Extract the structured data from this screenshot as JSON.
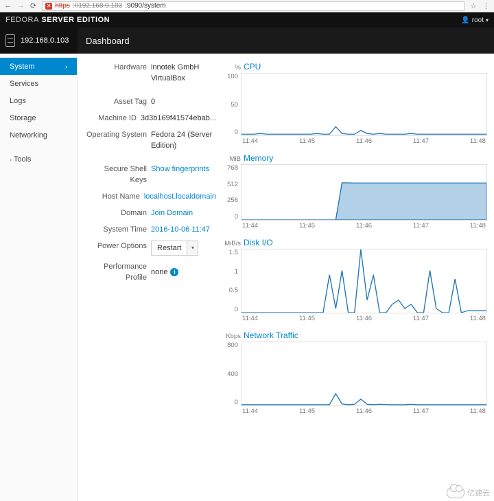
{
  "browser": {
    "url_scheme": "https",
    "url_host": "://192.168.0.103",
    "url_path": ":9090/system"
  },
  "brand": {
    "fedora": "FEDORA",
    "server": "SERVER EDITION"
  },
  "user": {
    "name": "root"
  },
  "host_tab": "192.168.0.103",
  "crumb": "Dashboard",
  "sidebar": {
    "items": [
      {
        "label": "System"
      },
      {
        "label": "Services"
      },
      {
        "label": "Logs"
      },
      {
        "label": "Storage"
      },
      {
        "label": "Networking"
      }
    ],
    "tools": "Tools"
  },
  "info": {
    "hardware_label": "Hardware",
    "hardware_value": "innotek GmbH\nVirtualBox",
    "asset_tag_label": "Asset Tag",
    "asset_tag_value": "0",
    "machine_id_label": "Machine ID",
    "machine_id_value": "3d3b169f41574ebab...",
    "os_label": "Operating System",
    "os_value": "Fedora 24 (Server\nEdition)",
    "ssh_label": "Secure Shell Keys",
    "ssh_value": "Show fingerprints",
    "host_label": "Host Name",
    "host_value": "localhost.localdomain",
    "domain_label": "Domain",
    "domain_value": "Join Domain",
    "time_label": "System Time",
    "time_value": "2016-10-06 11:47",
    "power_label": "Power Options",
    "power_value": "Restart",
    "perf_label": "Performance Profile",
    "perf_value": "none"
  },
  "x_ticks": [
    "11:44",
    "11:45",
    "11:46",
    "11:47",
    "11:48"
  ],
  "chart_data": [
    {
      "type": "line",
      "title": "CPU",
      "unit": "%",
      "ylim": [
        0,
        100
      ],
      "y_ticks": [
        100,
        50,
        0
      ],
      "x": [
        "11:44",
        "11:45",
        "11:46",
        "11:47",
        "11:48"
      ],
      "values": [
        2,
        2,
        2,
        3,
        2,
        2,
        2,
        2,
        2,
        2,
        2,
        2,
        3,
        2,
        2,
        14,
        3,
        2,
        2,
        8,
        3,
        2,
        3,
        2,
        2,
        2,
        2,
        3,
        2,
        2,
        2,
        2,
        2,
        2,
        2,
        2,
        2,
        2,
        2,
        2
      ]
    },
    {
      "type": "area",
      "title": "Memory",
      "unit": "MiB",
      "ylim": [
        0,
        768
      ],
      "y_ticks": [
        768,
        512,
        256,
        0
      ],
      "x": [
        "11:44",
        "11:45",
        "11:46",
        "11:47",
        "11:48"
      ],
      "values": [
        0,
        0,
        0,
        0,
        0,
        0,
        0,
        0,
        0,
        0,
        0,
        0,
        0,
        0,
        0,
        0,
        520,
        518,
        516,
        516,
        516,
        516,
        516,
        516,
        516,
        516,
        516,
        516,
        516,
        516,
        516,
        516,
        516,
        516,
        516,
        516,
        516,
        516,
        516,
        516
      ]
    },
    {
      "type": "line",
      "title": "Disk I/O",
      "unit": "MiB/s",
      "ylim": [
        0,
        1.5
      ],
      "y_ticks": [
        1.5,
        1,
        0.5,
        0
      ],
      "x": [
        "11:44",
        "11:45",
        "11:46",
        "11:47",
        "11:48"
      ],
      "values": [
        0,
        0,
        0,
        0,
        0,
        0,
        0,
        0,
        0,
        0,
        0,
        0,
        0,
        0,
        0.9,
        0.1,
        1.0,
        0,
        0,
        1.5,
        0.3,
        0.9,
        0,
        0,
        0.2,
        0.3,
        0.1,
        0.2,
        0,
        0,
        1.0,
        0.1,
        0,
        0,
        0.8,
        0,
        0.05,
        0.05,
        0.05,
        0.05
      ]
    },
    {
      "type": "line",
      "title": "Network Traffic",
      "unit": "Kbps",
      "ylim": [
        0,
        800
      ],
      "y_ticks": [
        800,
        400,
        0
      ],
      "x": [
        "11:44",
        "11:45",
        "11:46",
        "11:47",
        "11:48"
      ],
      "values": [
        10,
        10,
        10,
        10,
        10,
        10,
        10,
        10,
        10,
        10,
        10,
        10,
        10,
        10,
        10,
        150,
        20,
        10,
        15,
        80,
        15,
        10,
        15,
        12,
        10,
        10,
        10,
        15,
        10,
        10,
        10,
        10,
        10,
        10,
        10,
        10,
        10,
        10,
        10,
        10
      ]
    }
  ],
  "watermark": "亿速云"
}
